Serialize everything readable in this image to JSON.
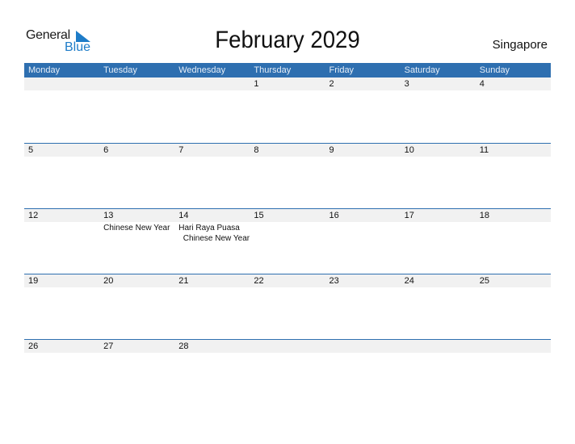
{
  "logo": {
    "word1": "General",
    "word2": "Blue"
  },
  "title": "February 2029",
  "country": "Singapore",
  "colors": {
    "header_bg": "#2e6fb0",
    "date_strip": "#f1f1f1",
    "logo_blue": "#1e7cc8"
  },
  "weekdays": [
    "Monday",
    "Tuesday",
    "Wednesday",
    "Thursday",
    "Friday",
    "Saturday",
    "Sunday"
  ],
  "weeks": [
    {
      "days": [
        "",
        "",
        "",
        "1",
        "2",
        "3",
        "4"
      ],
      "events": [
        [],
        [],
        [],
        [],
        [],
        [],
        []
      ]
    },
    {
      "days": [
        "5",
        "6",
        "7",
        "8",
        "9",
        "10",
        "11"
      ],
      "events": [
        [],
        [],
        [],
        [],
        [],
        [],
        []
      ]
    },
    {
      "days": [
        "12",
        "13",
        "14",
        "15",
        "16",
        "17",
        "18"
      ],
      "events": [
        [],
        [
          "Chinese New Year"
        ],
        [
          "Hari Raya Puasa",
          "  Chinese New Year"
        ],
        [],
        [],
        [],
        []
      ]
    },
    {
      "days": [
        "19",
        "20",
        "21",
        "22",
        "23",
        "24",
        "25"
      ],
      "events": [
        [],
        [],
        [],
        [],
        [],
        [],
        []
      ]
    },
    {
      "days": [
        "26",
        "27",
        "28",
        "",
        "",
        "",
        ""
      ],
      "events": [
        [],
        [],
        [],
        [],
        [],
        [],
        []
      ]
    }
  ]
}
